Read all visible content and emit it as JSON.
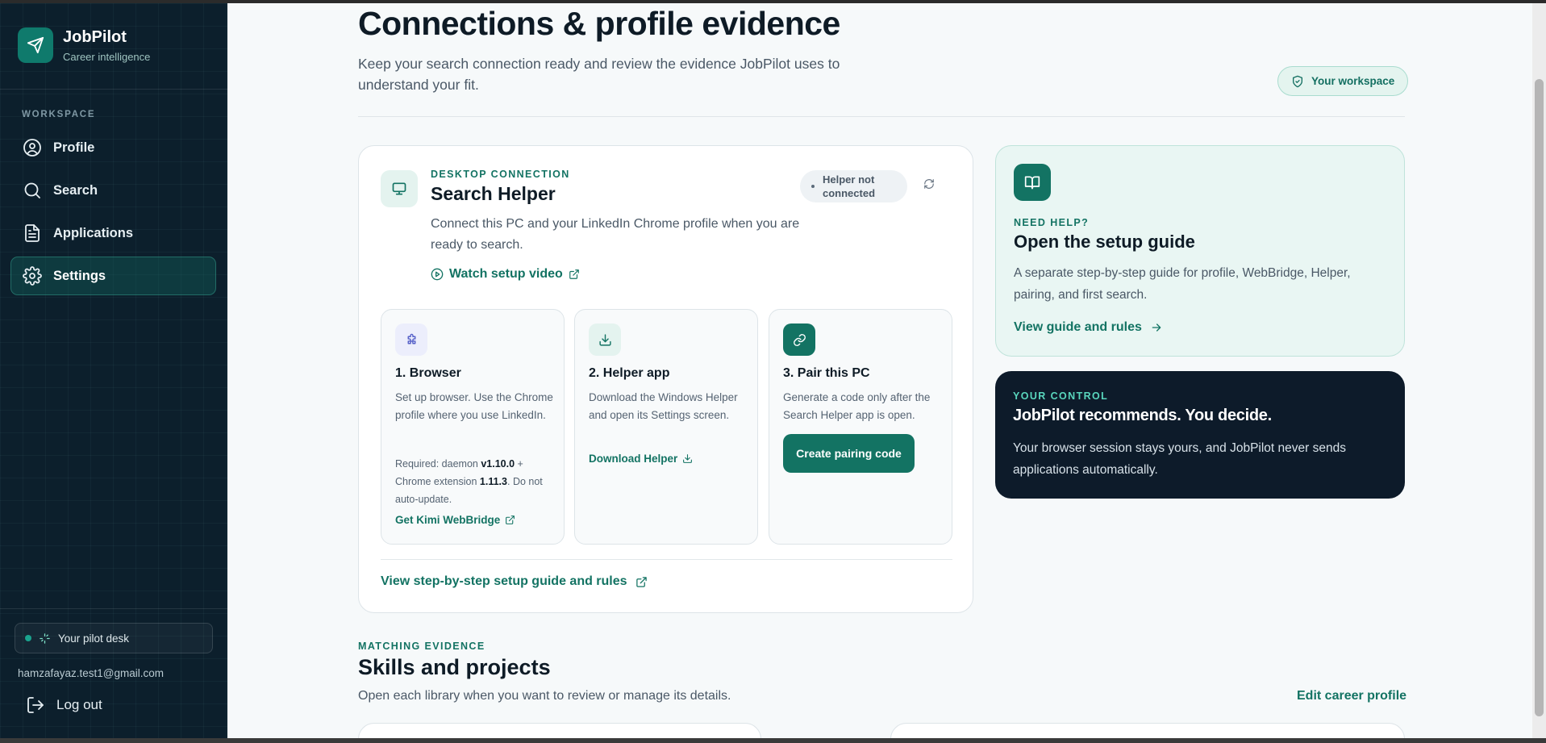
{
  "app": {
    "name": "JobPilot",
    "tagline": "Career intelligence"
  },
  "sidebar": {
    "section_label": "WORKSPACE",
    "items": [
      {
        "label": "Profile",
        "icon": "user-circle-icon",
        "active": false
      },
      {
        "label": "Search",
        "icon": "search-icon",
        "active": false
      },
      {
        "label": "Applications",
        "icon": "document-icon",
        "active": false
      },
      {
        "label": "Settings",
        "icon": "gear-icon",
        "active": true
      }
    ],
    "pilot_desk": "Your pilot desk",
    "email": "hamzafayaz.test1@gmail.com",
    "logout": "Log out"
  },
  "header": {
    "title": "Connections & profile evidence",
    "subtitle": "Keep your search connection ready and review the evidence JobPilot uses to understand your fit.",
    "workspace_badge": "Your workspace"
  },
  "connection": {
    "eyebrow": "DESKTOP CONNECTION",
    "title": "Search Helper",
    "description": "Connect this PC and your LinkedIn Chrome profile when you are ready to search.",
    "status_line1": "Helper not",
    "status_line2": "connected",
    "watch_video": "Watch setup video",
    "steps": {
      "browser": {
        "title": "1. Browser",
        "description": "Set up browser. Use the Chrome profile where you use LinkedIn.",
        "req_prefix": "Required: daemon ",
        "daemon_version": "v1.10.0",
        "req_middle": " + Chrome extension ",
        "extension_version": "1.11.3",
        "req_suffix": ". Do not auto-update.",
        "link": "Get Kimi WebBridge"
      },
      "helper": {
        "title": "2. Helper app",
        "description": "Download the Windows Helper and open its Settings screen.",
        "link": "Download Helper"
      },
      "pair": {
        "title": "3. Pair this PC",
        "description": "Generate a code only after the Search Helper app is open.",
        "button": "Create pairing code"
      }
    },
    "guide_link": "View step-by-step setup guide and rules"
  },
  "help": {
    "eyebrow": "NEED HELP?",
    "title": "Open the setup guide",
    "description": "A separate step-by-step guide for profile, WebBridge, Helper, pairing, and first search.",
    "link": "View guide and rules"
  },
  "control": {
    "eyebrow": "YOUR CONTROL",
    "title": "JobPilot recommends. You decide.",
    "description": "Your browser session stays yours, and JobPilot never sends applications automatically."
  },
  "evidence": {
    "eyebrow": "MATCHING EVIDENCE",
    "title": "Skills and projects",
    "subtitle": "Open each library when you want to review or manage its details.",
    "edit_link": "Edit career profile"
  },
  "colors": {
    "accent": "#137363",
    "sidebar_bg": "#0c1f2c",
    "dark_card": "#0d1b2a",
    "help_bg": "#e9f6f3"
  }
}
